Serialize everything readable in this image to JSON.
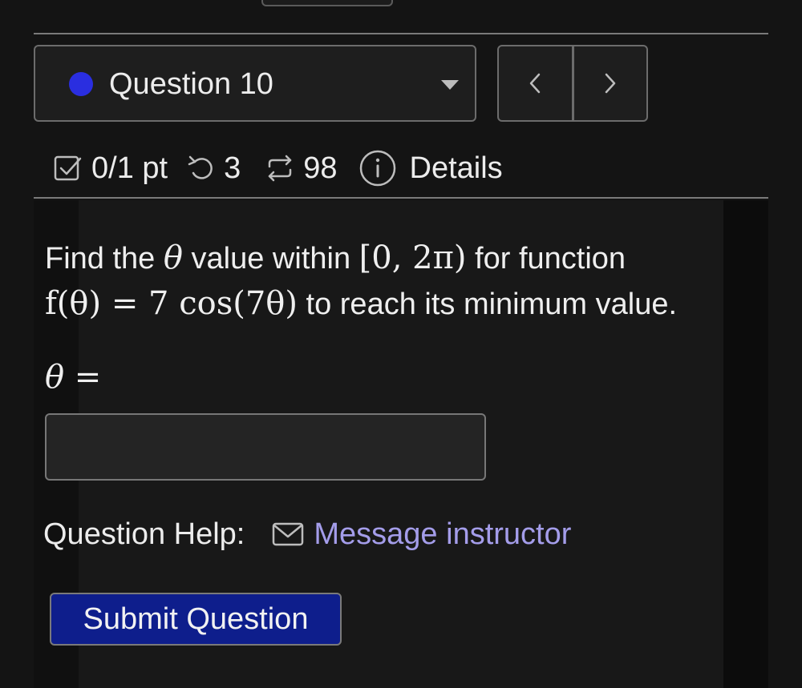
{
  "question_select": {
    "label": "Question 10",
    "status_color": "#2a2ee0"
  },
  "nav": {
    "prev_icon": "chevron-left-icon",
    "next_icon": "chevron-right-icon"
  },
  "meta": {
    "score": "0/1 pt",
    "retries": "3",
    "attempts": "98",
    "details_label": "Details"
  },
  "problem": {
    "text_prefix": "Find the",
    "text_mid": "value within",
    "text_suffix": "for function",
    "text_end": "to reach its minimum value.",
    "math_theta": "θ",
    "math_interval": "[0, 2π)",
    "math_function": "f(θ) = 7 cos(7θ)"
  },
  "answer": {
    "label": "θ =",
    "value": "",
    "placeholder": ""
  },
  "help": {
    "label": "Question Help:",
    "link_label": "Message instructor"
  },
  "submit": {
    "label": "Submit Question",
    "color": "#0e1e8c"
  },
  "colors": {
    "background": "#141414",
    "link": "#a49dea",
    "border": "#6c6c6c"
  }
}
